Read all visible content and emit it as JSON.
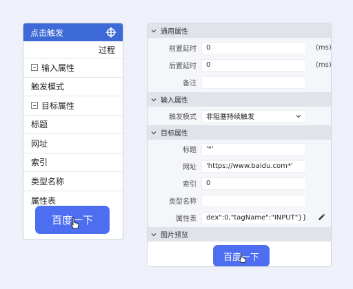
{
  "left_card": {
    "title": "点击触发",
    "title_icon": "crosshair-icon",
    "subheader": "过程",
    "rows": [
      {
        "label": "输入属性",
        "collapsible": true
      },
      {
        "label": "触发模式",
        "collapsible": false
      },
      {
        "label": "目标属性",
        "collapsible": true
      },
      {
        "label": "标题",
        "collapsible": false
      },
      {
        "label": "网址",
        "collapsible": false
      },
      {
        "label": "索引",
        "collapsible": false
      },
      {
        "label": "类型名称",
        "collapsible": false
      },
      {
        "label": "属性表",
        "collapsible": false
      }
    ],
    "preview_button": "百度一下"
  },
  "right_panel": {
    "general": {
      "title": "通用属性",
      "pre_delay_label": "前置延时",
      "pre_delay_value": "0",
      "pre_delay_unit": "(ms)",
      "post_delay_label": "后置延时",
      "post_delay_value": "0",
      "post_delay_unit": "(ms)",
      "note_label": "备注",
      "note_value": ""
    },
    "input": {
      "title": "输入属性",
      "trigger_mode_label": "触发模式",
      "trigger_mode_value": "非阻塞持续触发"
    },
    "target": {
      "title": "目标属性",
      "title_label": "标题",
      "title_value": "'*'",
      "url_label": "网址",
      "url_value": "'https://www.baidu.com*'",
      "index_label": "索引",
      "index_value": "0",
      "type_label": "类型名称",
      "type_value": "",
      "attrs_label": "属性表",
      "attrs_value": "dex\":0,\"tagName\":\"INPUT\"}}]}"
    },
    "preview": {
      "title": "图片预览",
      "button": "百度一下"
    }
  },
  "colors": {
    "accent": "#3d6ad6",
    "baidu_button": "#4e6ef2",
    "section_bg": "#e0e4ea",
    "page_bg": "#eef1f9"
  }
}
